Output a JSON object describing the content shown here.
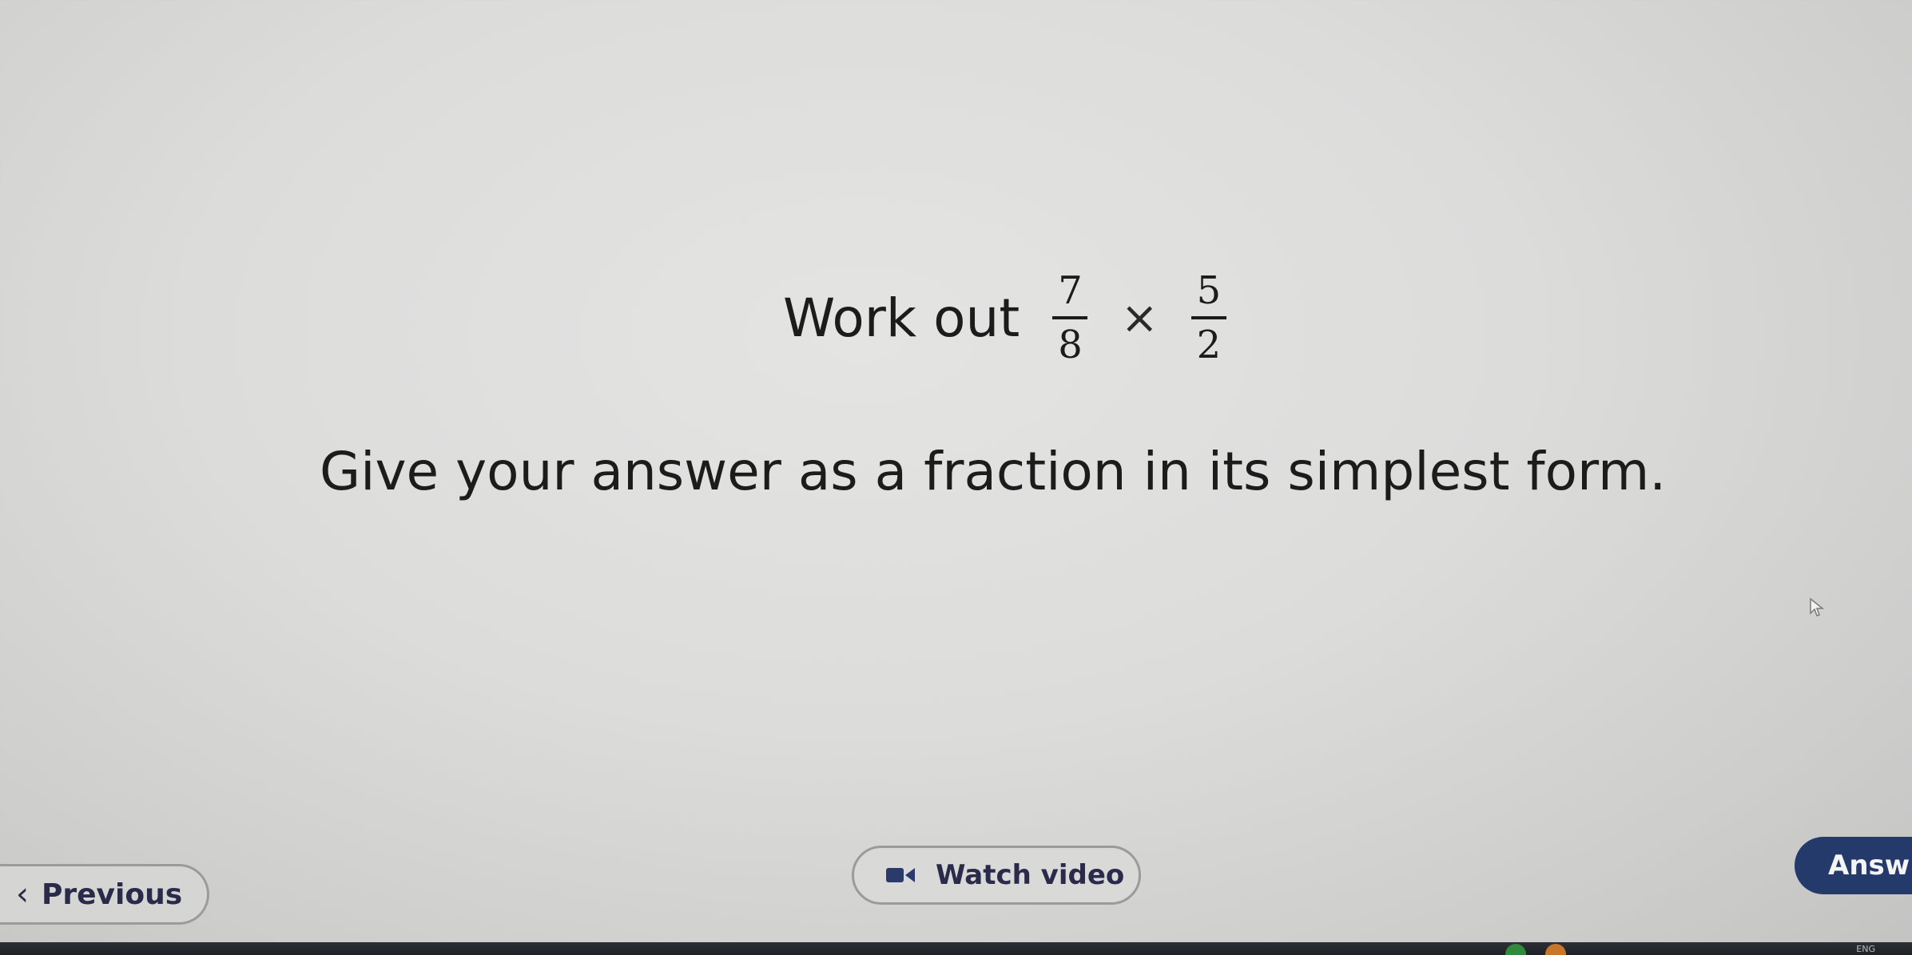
{
  "question": {
    "lead": "Work out",
    "fraction_a": {
      "numerator": "7",
      "denominator": "8"
    },
    "operator": "×",
    "fraction_b": {
      "numerator": "5",
      "denominator": "2"
    }
  },
  "instruction": "Give your answer as a fraction in its simplest form.",
  "nav": {
    "previous_label": "Previous",
    "watch_video_label": "Watch video",
    "answer_label": "Answ"
  },
  "taskbar": {
    "language": "ENG"
  },
  "colors": {
    "answer_button": "#243a6b",
    "button_text": "#2a2a4a",
    "background": "#dcdcdb"
  }
}
